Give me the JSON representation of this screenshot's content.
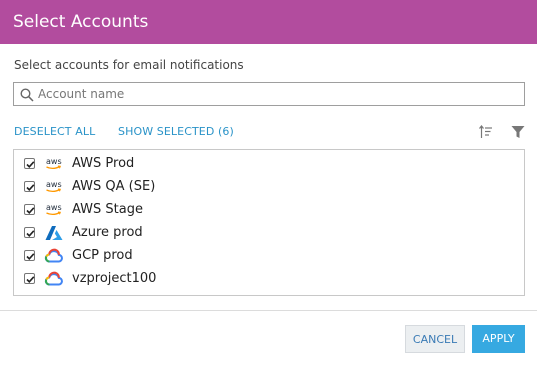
{
  "dialog": {
    "title": "Select Accounts",
    "subtitle": "Select accounts for email notifications"
  },
  "search": {
    "placeholder": "Account name",
    "value": ""
  },
  "actions": {
    "deselect_all": "DESELECT ALL",
    "show_selected": "SHOW SELECTED (6)"
  },
  "toolbar_icons": [
    "sort-icon",
    "filter-icon"
  ],
  "accounts": [
    {
      "name": "AWS Prod",
      "provider": "aws",
      "checked": true
    },
    {
      "name": "AWS QA (SE)",
      "provider": "aws",
      "checked": true
    },
    {
      "name": "AWS Stage",
      "provider": "aws",
      "checked": true
    },
    {
      "name": "Azure prod",
      "provider": "azure",
      "checked": true
    },
    {
      "name": "GCP prod",
      "provider": "gcp",
      "checked": true
    },
    {
      "name": "vzproject100",
      "provider": "gcp",
      "checked": true
    }
  ],
  "footer": {
    "cancel_label": "CANCEL",
    "apply_label": "APPLY"
  },
  "colors": {
    "header": "#b24c9e",
    "accent": "#2a93c8",
    "apply": "#36a9e1"
  }
}
